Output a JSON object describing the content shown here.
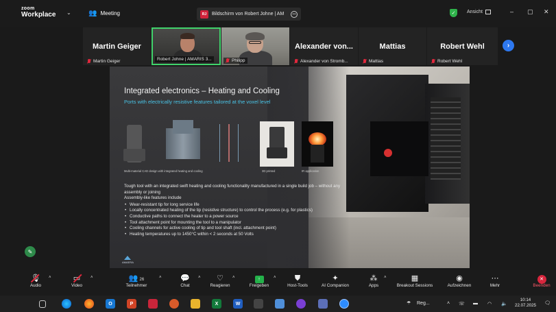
{
  "titlebar": {
    "brand_top": "zoom",
    "brand_bottom": "Workplace",
    "meeting_label": "Meeting",
    "share_badge": "RJ",
    "share_title": "Bildschirm von Robert Johne | AM",
    "view_label": "Ansicht",
    "minimize": "–",
    "maximize": "▢",
    "close": "✕"
  },
  "participants": [
    {
      "name": "Martin Geiger",
      "label": "Martin Geiger",
      "muted": true
    },
    {
      "name": "",
      "label": "Robert Johne | AMARIS 3...",
      "muted": false,
      "video": true,
      "active": true
    },
    {
      "name": "",
      "label": "Philipp",
      "muted": true,
      "video": true
    },
    {
      "name": "Alexander von...",
      "label": "Alexander von Stromb...",
      "muted": true
    },
    {
      "name": "Mattias",
      "label": "Mattias",
      "muted": true
    },
    {
      "name": "Robert Wehl",
      "label": "Robert Wehl",
      "muted": true
    }
  ],
  "next_arrow": "›",
  "slide": {
    "title": "Integrated electronics – Heating and Cooling",
    "subtitle": "Ports with electrically resistive features tailored at the voxel level",
    "caption_cad": "Multi-material CAD design with integrated heating and cooling",
    "caption_3d": "3D printed",
    "caption_ir": "IR application",
    "body_lead": "Tough tool with an integrated swift heating and cooling functionality manufactured in a single build job – without any assembly or joining",
    "list_title": "Assembly-like features include",
    "bullets": [
      "Wear-resistant tip for long service life",
      "Locally concentrated heating of the tip (resistive structure) to control the process (e.g. for plastics)",
      "Conductive paths to connect the heater to a power source",
      "Tool attachment point for mounting the tool to a manipulator",
      "Cooling channels for active cooling of tip and tool shaft (incl. attachment point)",
      "Heating temperatures up to 1450°C within < 2 seconds at 50 Volts"
    ],
    "logo_text": "AMAERA"
  },
  "toolbar": {
    "audio": "Audio",
    "video": "Video",
    "participants": "Teilnehmer",
    "participants_count": "26",
    "chat": "Chat",
    "react": "Reagieren",
    "share": "Freigeben",
    "host_tools": "Host-Tools",
    "ai_companion": "AI Companion",
    "apps": "Apps",
    "breakout": "Breakout Sessions",
    "record": "Aufzeichnen",
    "more": "Mehr",
    "end": "Beenden"
  },
  "taskbar": {
    "weather": "Reg...",
    "time": "10:14",
    "date": "22.07.2025"
  },
  "colors": {
    "accent_green": "#40d36b",
    "zoom_blue": "#2d78f0",
    "end_red": "#d8263d",
    "slide_cyan": "#49c3e6"
  }
}
